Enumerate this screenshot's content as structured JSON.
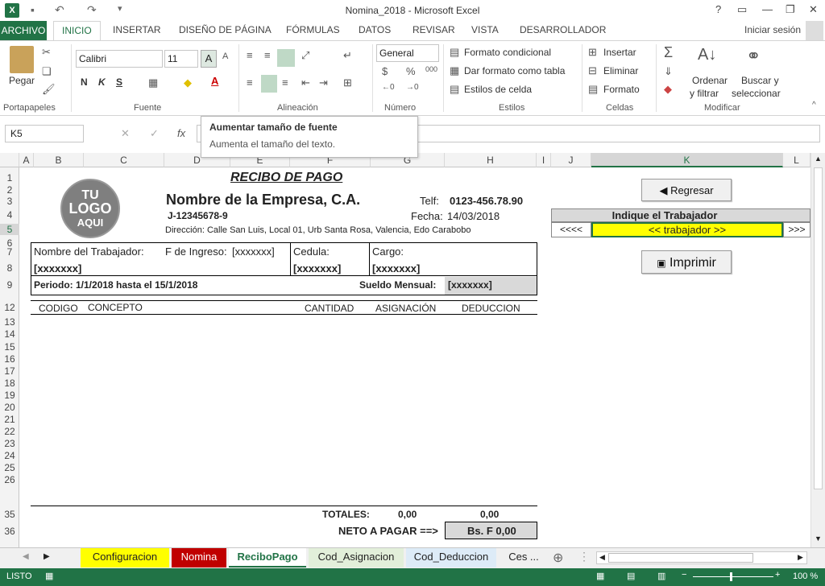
{
  "app": {
    "title": "Nomina_2018 - Microsoft Excel",
    "help": "?",
    "signin": "Iniciar sesión"
  },
  "tabs": [
    "ARCHIVO",
    "INICIO",
    "INSERTAR",
    "DISEÑO DE PÁGINA",
    "FÓRMULAS",
    "DATOS",
    "REVISAR",
    "VISTA",
    "DESARROLLADOR"
  ],
  "ribbon": {
    "paste": "Pegar",
    "font_name": "Calibri",
    "font_size": "11",
    "number_format": "General",
    "bold": "N",
    "italic": "K",
    "underline": "S",
    "cond_format": "Formato condicional",
    "table_format": "Dar formato como tabla",
    "cell_styles": "Estilos de celda",
    "insert": "Insertar",
    "delete": "Eliminar",
    "format": "Formato",
    "sort": "Ordenar",
    "sort2": "y filtrar",
    "find": "Buscar y",
    "find2": "seleccionar",
    "groups": [
      "Portapapeles",
      "Fuente",
      "Alineación",
      "Número",
      "Estilos",
      "Celdas",
      "Modificar"
    ]
  },
  "formula_bar": {
    "name_box": "K5",
    "fx": "fx"
  },
  "tooltip": {
    "title": "Aumentar tamaño de fuente",
    "desc": "Aumenta el tamaño del texto."
  },
  "columns": [
    "A",
    "B",
    "C",
    "D",
    "E",
    "F",
    "G",
    "H",
    "I",
    "J",
    "K",
    "L"
  ],
  "rows": [
    "1",
    "2",
    "3",
    "4",
    "5",
    "6",
    "7",
    "8",
    "9",
    "12",
    "13",
    "14",
    "15",
    "16",
    "17",
    "18",
    "19",
    "20",
    "21",
    "22",
    "23",
    "24",
    "25",
    "26",
    "35",
    "36"
  ],
  "receipt": {
    "title": "RECIBO DE PAGO",
    "logo": [
      "TU",
      "LOGO",
      "AQUI"
    ],
    "company": "Nombre de la Empresa, C.A.",
    "rif": "J-12345678-9",
    "phone_label": "Telf:",
    "phone": "0123-456.78.90",
    "date_label": "Fecha:",
    "date": "14/03/2018",
    "address": "Dirección: Calle San Luis, Local 01, Urb Santa Rosa, Valencia, Edo Carabobo",
    "worker_label": "Nombre del Trabajador:",
    "hire_label": "F de Ingreso:",
    "hire_value": "[xxxxxxx]",
    "cedula_label": "Cedula:",
    "cargo_label": "Cargo:",
    "worker_value": "[xxxxxxx]",
    "cedula_value": "[xxxxxxx]",
    "cargo_value": "[xxxxxxx]",
    "period": "Periodo:  1/1/2018 hasta el 15/1/2018",
    "salary_label": "Sueldo Mensual:",
    "salary_value": "[xxxxxxx]",
    "headers": {
      "code": "CODIGO",
      "concept": "CONCEPTO",
      "qty": "CANTIDAD",
      "assign": "ASIGNACIÓN",
      "deduct": "DEDUCCION"
    },
    "totals_label": "TOTALES:",
    "total_assign": "0,00",
    "total_deduct": "0,00",
    "net_label": "NETO A PAGAR ==>",
    "net_value": "Bs. F 0,00"
  },
  "panel": {
    "back": "◀ Regresar",
    "select_label": "Indique el Trabajador",
    "prev": "<<<<",
    "worker": "<< trabajador >>",
    "next": ">>>",
    "print": "Imprimir"
  },
  "sheets": [
    "Configuracion",
    "Nomina",
    "ReciboPago",
    "Cod_Asignacion",
    "Cod_Deduccion",
    "Ces ..."
  ],
  "colors": {
    "excel_green": "#217346",
    "config_tab": "#ffff00",
    "nomina_tab": "#c00000",
    "asign_tab": "#e2efda",
    "deduc_tab": "#ddebf7",
    "highlight": "#ffff00"
  },
  "status": {
    "ready": "LISTO",
    "zoom": "100 %"
  }
}
